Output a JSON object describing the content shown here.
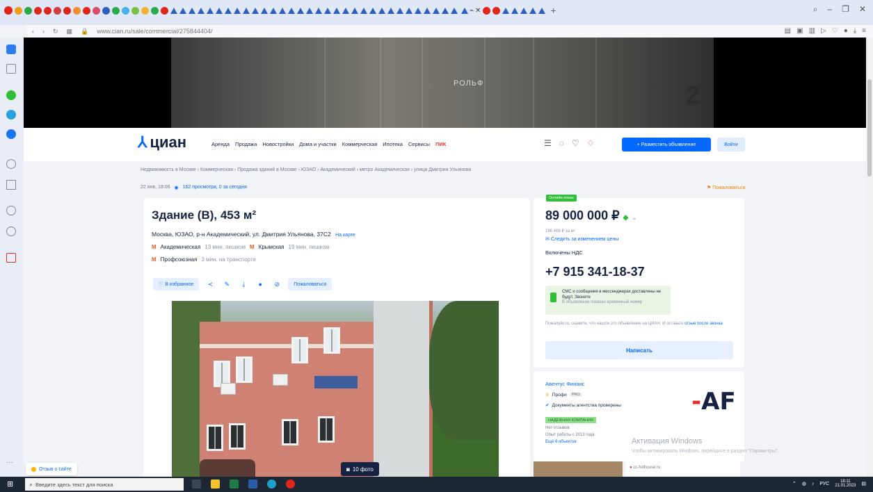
{
  "browser": {
    "url": "www.cian.ru/sale/commercial/275844404/",
    "new_tab": "+",
    "win_min": "–",
    "win_max": "❐",
    "win_close": "✕"
  },
  "header": {
    "logo_mark": "⅄",
    "logo_text": "циан",
    "nav": [
      "Аренда",
      "Продажа",
      "Новостройки",
      "Дома и участки",
      "Коммерческая",
      "Ипотека",
      "Сервисы",
      "ПИК"
    ],
    "post_button": "+ Разместить объявление",
    "login_button": "Войти"
  },
  "banner": {
    "brand": "РОЛЬФ",
    "number": "2"
  },
  "listing": {
    "breadcrumbs": "Недвижимость в Москве › Коммерческая › Продажа зданий в Москве › ЮЗАО › Академический › метро Академическая › улица Дмитрия Ульянова",
    "date": "22 янв, 18:06",
    "views": "162 просмотра, 0 за сегодня",
    "complain": "Пожаловаться",
    "title": "Здание (В), 453 м²",
    "address": "Москва, ЮЗАО, р-н Академический, ул. Дмитрия Ульянова, 37С2",
    "map_link": "На карте",
    "metro": [
      {
        "name": "Академическая",
        "time": "13 мин. пешком"
      },
      {
        "name": "Крымская",
        "time": "19 мин. пешком"
      },
      {
        "name": "Профсоюзная",
        "time": "3 мин. на транспорте"
      }
    ],
    "fav_button": "В избранное",
    "report_button": "Пожаловаться",
    "photo_count": "10 фото"
  },
  "offer": {
    "online_badge": "Онлайн-показ",
    "price": "89 000 000 ₽",
    "price_per_m": "196 468 ₽ за м²",
    "subscribe": "Следить за изменением цены",
    "vat": "Включены НДС",
    "phone": "+7 915 341-18-37",
    "sms_text": "СМС и сообщения в мессенджерах доставлены не будут. Звоните",
    "sms_sub": "В объявлении показан временный номер",
    "note_text": "Пожалуйста, скажите, что нашли это объявление на ЦИАН. И оставьте",
    "note_link": "отзыв после звонка",
    "write_button": "Написать"
  },
  "agent": {
    "name": "Авентус Финанс",
    "pro_label": "Профи",
    "pro_badge": "PRO",
    "docs_checked": "Документы агентства проверены",
    "badge": "НАДЁЖНАЯ КОМПАНИЯ",
    "reviews": "Нет отзывов",
    "experience": "Опыт работы с 2013 года",
    "more": "Ещё 6 объектов",
    "logo": "AF"
  },
  "windows": {
    "watermark": "Активация Windows",
    "watermark_sub": "Чтобы активировать Windows, перейдите в раздел \"Параметры\".",
    "search_placeholder": "Введите здесь текст для поиска",
    "lang": "РУС",
    "time": "18:11",
    "date": "21.01.2023"
  },
  "footer": {
    "feedback": "Отзыв о сайте",
    "bottom_card": "cc-fullhouse.ru"
  },
  "colors": {
    "brand_blue": "#0468ff",
    "dark_text": "#152242",
    "online_green": "#2fbf3a",
    "pik_red": "#e83a2e"
  }
}
